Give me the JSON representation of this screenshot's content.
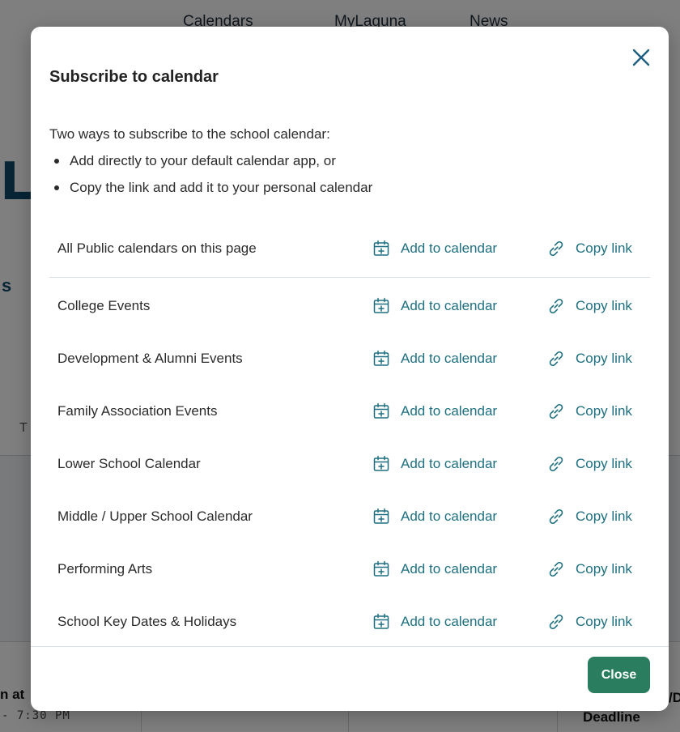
{
  "background": {
    "nav": [
      "Calendars",
      "MyLaguna",
      "News"
    ],
    "title_fragment": "LE",
    "section_fragment": "s",
    "column_fragment": "T",
    "event_fragment": "n at",
    "time_fragment": "- 7:30 PM",
    "right_fragment": "/D",
    "deadline_fragment": "Deadline"
  },
  "modal": {
    "title": "Subscribe to calendar",
    "intro": "Two ways to subscribe to the school calendar:",
    "bullets": [
      "Add directly to your default calendar app, or",
      "Copy the link and add it to your personal calendar"
    ],
    "add_label": "Add to calendar",
    "copy_label": "Copy link",
    "calendars": [
      "All Public calendars on this page",
      "College Events",
      "Development & Alumni Events",
      "Family Association Events",
      "Lower School Calendar",
      "Middle / Upper School Calendar",
      "Performing Arts",
      "School Key Dates & Holidays"
    ],
    "close_label": "Close",
    "icons": {
      "close": "close-x-icon",
      "add": "calendar-add-icon",
      "copy": "link-icon"
    },
    "colors": {
      "accent": "#1e6f80",
      "button": "#2a7d5f",
      "overlay": "rgba(0,0,0,0.5)"
    }
  }
}
